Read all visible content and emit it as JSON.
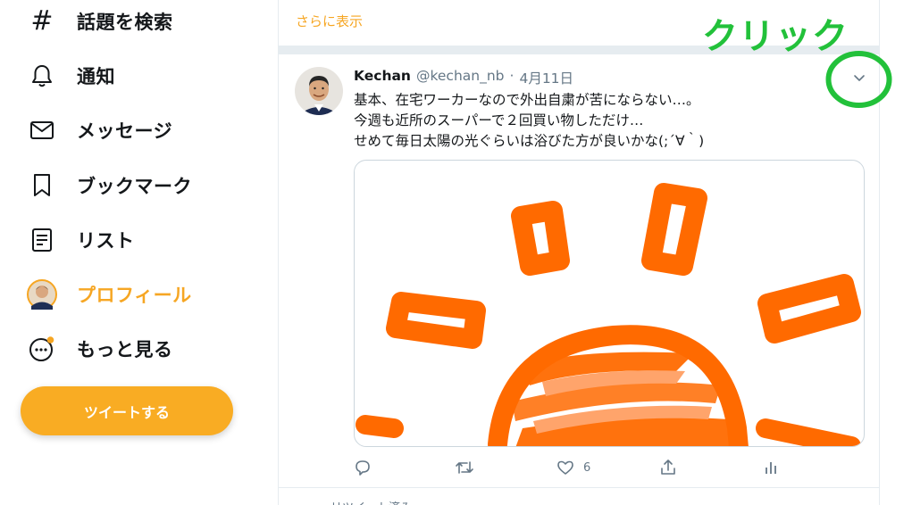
{
  "nav": {
    "items": [
      {
        "label": "話題を検索",
        "icon": "hashtag-icon"
      },
      {
        "label": "通知",
        "icon": "bell-icon"
      },
      {
        "label": "メッセージ",
        "icon": "envelope-icon"
      },
      {
        "label": "ブックマーク",
        "icon": "bookmark-icon"
      },
      {
        "label": "リスト",
        "icon": "list-icon"
      },
      {
        "label": "プロフィール",
        "icon": "profile-avatar-icon"
      },
      {
        "label": "もっと見る",
        "icon": "more-dots-icon"
      }
    ],
    "hash_glyph": "#",
    "tweet_button_label": "ツイートする"
  },
  "timeline": {
    "show_more": "さらに表示",
    "tweet": {
      "author_name": "Kechan",
      "author_handle": "@kechan_nb",
      "separator": "·",
      "date": "4月11日",
      "lines": [
        "基本、在宅ワーカーなので外出自粛が苦にならない…。",
        "今週も近所のスーパーで２回買い物しただけ…",
        "せめて毎日太陽の光ぐらいは浴びた方が良いかな(;´∀｀)"
      ],
      "like_count": "6"
    },
    "next_tweet_text": "リツイート済み"
  },
  "annotation": {
    "text": "クリック",
    "color": "#22c13a"
  },
  "colors": {
    "accent": "#f6a623",
    "button": "#f9ac23",
    "sun_orange": "#ff6a00",
    "annotation_green": "#22c13a"
  }
}
